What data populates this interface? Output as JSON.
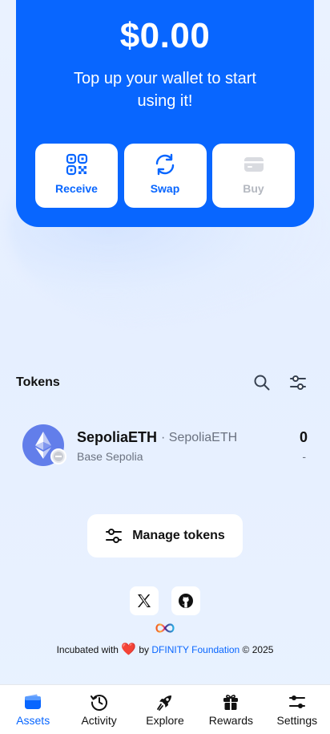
{
  "balance": {
    "amount": "$0.00",
    "subtitle": "Top up your wallet to start using it!"
  },
  "actions": [
    {
      "label": "Receive",
      "icon": "qr-code-icon"
    },
    {
      "label": "Swap",
      "icon": "swap-icon"
    },
    {
      "label": "Buy",
      "icon": "card-icon",
      "disabled": true
    }
  ],
  "tokens": {
    "title": "Tokens",
    "list": [
      {
        "name": "SepoliaETH",
        "symbol": "· SepoliaETH",
        "network": "Base Sepolia",
        "balance": "0",
        "usd": "-"
      }
    ],
    "manage_label": "Manage tokens"
  },
  "social": [
    "x-logo-icon",
    "github-icon"
  ],
  "footer": {
    "prefix": "Incubated with",
    "by": "by",
    "org": "DFINITY Foundation",
    "year": "© 2025"
  },
  "nav": [
    {
      "label": "Assets",
      "icon": "wallet-icon",
      "active": true
    },
    {
      "label": "Activity",
      "icon": "history-icon"
    },
    {
      "label": "Explore",
      "icon": "rocket-icon"
    },
    {
      "label": "Rewards",
      "icon": "gift-icon"
    },
    {
      "label": "Settings",
      "icon": "settings-sliders-icon"
    }
  ],
  "colors": {
    "accent": "#0866ff",
    "background": "#e8f1ff",
    "muted": "#6b7280",
    "heart": "#e02424"
  }
}
